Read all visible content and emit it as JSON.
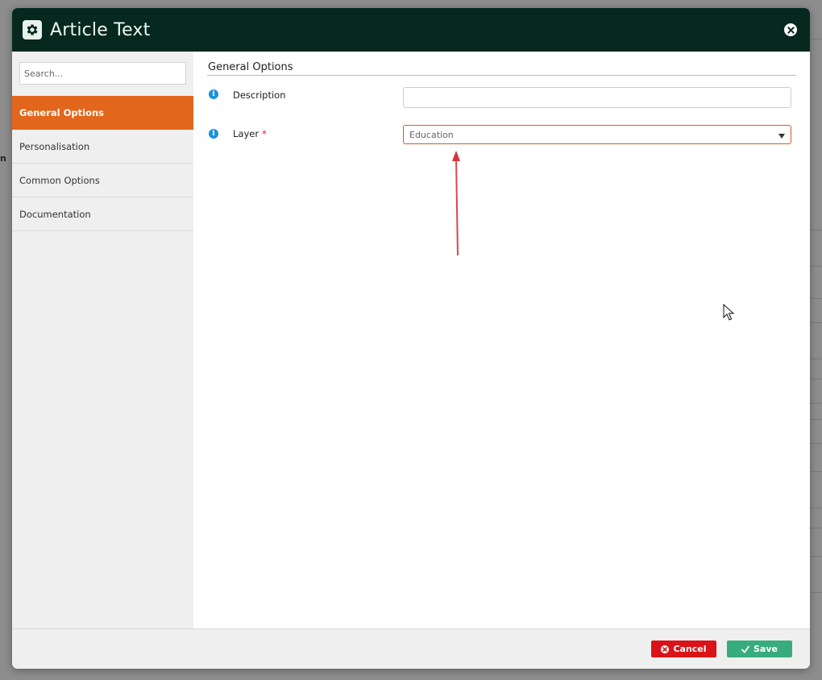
{
  "window": {
    "title": "Article Text",
    "header_icon": "gear-icon",
    "close_icon": "close-icon"
  },
  "background": {
    "partial_text": "n"
  },
  "sidebar": {
    "search_placeholder": "Search...",
    "items": [
      {
        "label": "General Options",
        "active": true
      },
      {
        "label": "Personalisation",
        "active": false
      },
      {
        "label": "Common Options",
        "active": false
      },
      {
        "label": "Documentation",
        "active": false
      }
    ]
  },
  "main": {
    "section_title": "General Options",
    "fields": [
      {
        "label": "Description",
        "required": false,
        "value": "",
        "type": "text"
      },
      {
        "label": "Layer",
        "required": true,
        "required_mark": "*",
        "value": "Education",
        "type": "select"
      }
    ]
  },
  "footer": {
    "cancel_label": "Cancel",
    "save_label": "Save"
  },
  "colors": {
    "header_bg": "#06281e",
    "accent_orange": "#e2661b",
    "cancel_red": "#d91317",
    "save_green": "#37ad7d",
    "info_blue": "#1a93d6",
    "annotation_red": "#d9323a"
  }
}
